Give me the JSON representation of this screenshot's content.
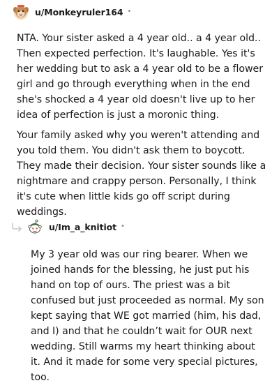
{
  "comment1": {
    "username": "u/Monkeyruler164",
    "separator": "•",
    "avatar_icon": "monkey-avatar-icon",
    "paragraphs": [
      "NTA. Your sister asked a 4 year old.. a 4 year old.. Then expected perfection. It's laughable. Yes it's her wedding but to ask a 4 year old to be a flower girl and go through everything when in the end she's shocked a 4 year old doesn't live up to her idea of perfection is just a moronic thing.",
      "Your family asked why you weren't attending and you told them. You didn't ask them to boycott. They made their decision. Your sister sounds like a nightmare and crappy person. Personally, I think it's cute when little kids go off script during weddings."
    ]
  },
  "comment2": {
    "username": "u/Im_a_knitiot",
    "separator": "•",
    "avatar_icon": "snoo-avatar-icon",
    "reply_icon": "reply-arrow-icon",
    "paragraphs": [
      "My 3 year old was our ring bearer. When we joined hands for the blessing, he just put his hand on top of ours. The priest was a bit confused but just proceeded as normal. My son kept saying that WE got married (him, his dad, and I) and that he couldn’t wait for OUR next wedding. Still warms my heart thinking about it. And it made for some very special pictures, too."
    ]
  }
}
